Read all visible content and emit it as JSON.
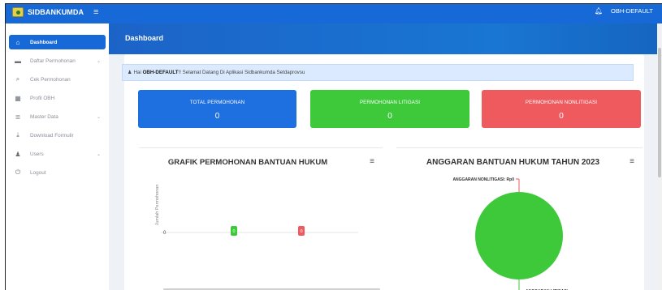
{
  "app": {
    "name": "SIDBANKUMDA",
    "user": "OBH-DEFAULT"
  },
  "sidebar": {
    "items": [
      {
        "label": "Dashboard",
        "icon": "home-icon",
        "active": true,
        "has_submenu": false
      },
      {
        "label": "Daftar Permohonan",
        "icon": "list-icon",
        "active": false,
        "has_submenu": true
      },
      {
        "label": "Cek Permohonan",
        "icon": "search-icon",
        "active": false,
        "has_submenu": false
      },
      {
        "label": "Profil OBH",
        "icon": "grid-icon",
        "active": false,
        "has_submenu": false
      },
      {
        "label": "Master Data",
        "icon": "database-icon",
        "active": false,
        "has_submenu": true
      },
      {
        "label": "Download Formulir",
        "icon": "download-icon",
        "active": false,
        "has_submenu": false
      },
      {
        "label": "Users",
        "icon": "user-icon",
        "active": false,
        "has_submenu": true
      },
      {
        "label": "Logout",
        "icon": "power-icon",
        "active": false,
        "has_submenu": false
      }
    ]
  },
  "main": {
    "title": "Dashboard",
    "greeting": {
      "prefix": "Hai",
      "name": "OBH-DEFAULT",
      "message": "!! Selamat Datang Di Aplikasi Sidbankumda Setdaprovsu"
    }
  },
  "stats": [
    {
      "label": "TOTAL PERMOHONAN",
      "value": "0",
      "color": "#1e6fe0"
    },
    {
      "label": "PERMOHONAN LITIGASI",
      "value": "0",
      "color": "#3ec93a"
    },
    {
      "label": "PERMOHONAN NONLITIGASI",
      "value": "0",
      "color": "#ef5a5f"
    }
  ],
  "chart_data": [
    {
      "type": "bar",
      "title": "GRAFIK PERMOHONAN BANTUAN HUKUM",
      "ylabel": "Jumlah Permohonan",
      "xlabel": "",
      "y_ticks": [
        "0"
      ],
      "series": [
        {
          "color": "#3ec93a",
          "values": [
            0
          ]
        },
        {
          "color": "#ef5a5f",
          "values": [
            0
          ]
        }
      ],
      "data_labels": [
        "0",
        "0"
      ]
    },
    {
      "type": "pie",
      "title": "ANGGARAN BANTUAN HUKUM TAHUN 2023",
      "slices": [
        {
          "label": "ANGGARAN NONLITIGASI: Rp0",
          "value": 0,
          "color": "#ef5a5f"
        },
        {
          "label": "ANGGARAN LITIGASI:",
          "value": 100,
          "color": "#3ec93a"
        }
      ]
    }
  ]
}
